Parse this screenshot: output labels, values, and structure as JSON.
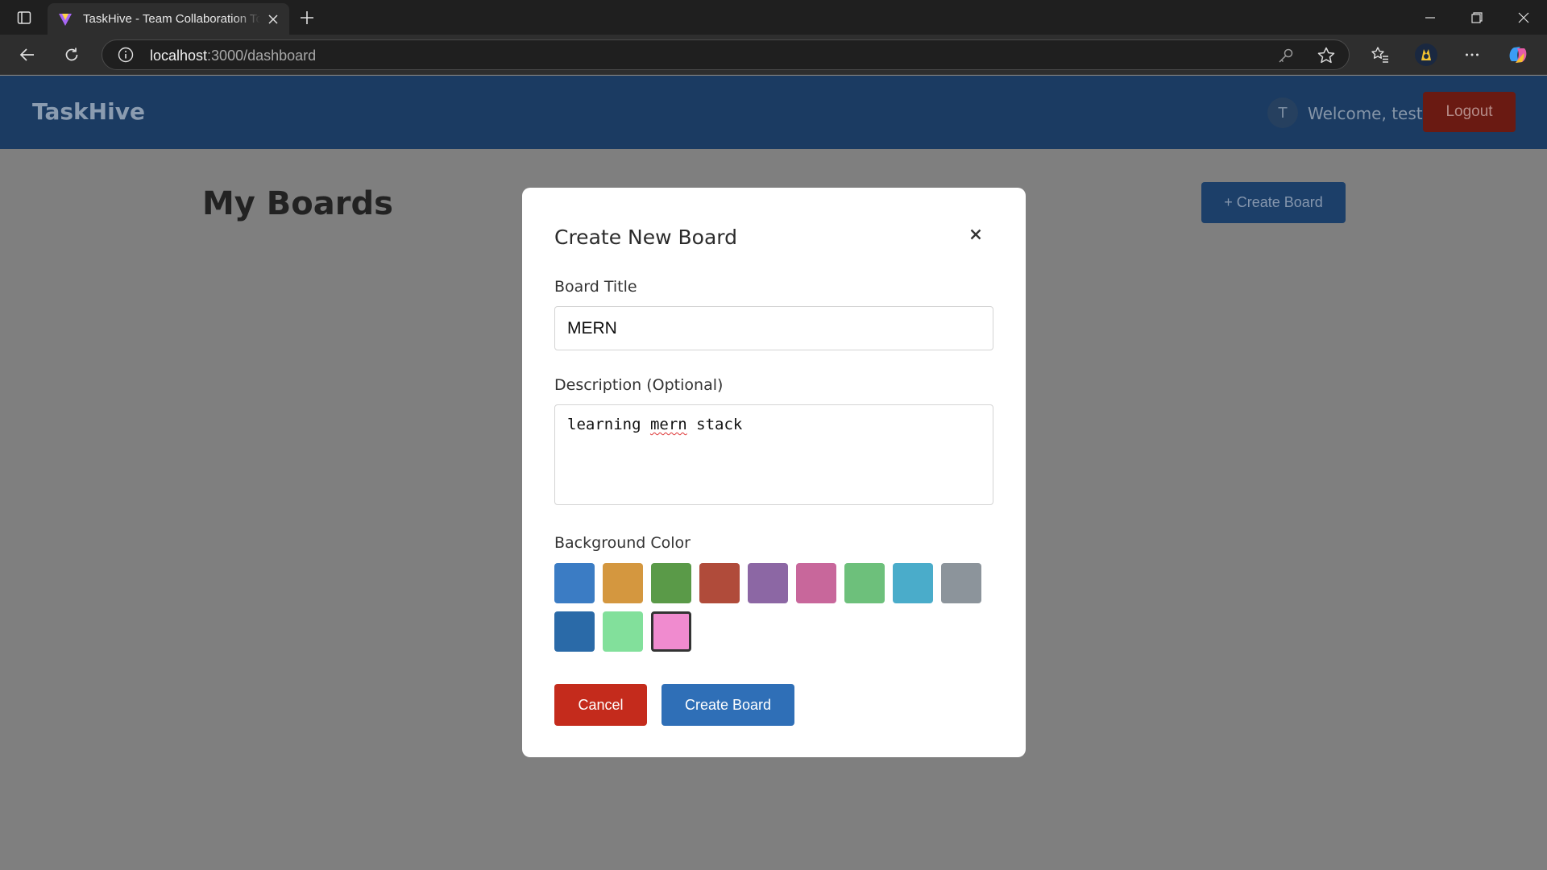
{
  "browser": {
    "tab_title": "TaskHive - Team Collaboration Tool",
    "url_host": "localhost",
    "url_path": ":3000/dashboard",
    "icons": [
      "tab-actions-icon",
      "favicon-icon",
      "tab-close-icon",
      "new-tab-icon",
      "minimize-icon",
      "restore-icon",
      "window-close-icon",
      "back-icon",
      "reload-icon",
      "site-info-icon",
      "password-key-icon",
      "favorite-star-icon",
      "favorites-icon",
      "profile-icon",
      "more-icon",
      "copilot-icon"
    ]
  },
  "header": {
    "logo": "TaskHive",
    "avatar_initial": "T",
    "welcome": "Welcome, test",
    "logout_label": "Logout"
  },
  "main": {
    "title": "My Boards",
    "create_button": "+ Create Board"
  },
  "modal": {
    "title": "Create New Board",
    "close_symbol": "×",
    "title_label": "Board Title",
    "title_value": "MERN",
    "description_label": "Description (Optional)",
    "description_value": "learning mern stack",
    "color_label": "Background Color",
    "colors": [
      "#3b7cc4",
      "#d4973f",
      "#5a9a48",
      "#b04b3a",
      "#8c67a4",
      "#c8679b",
      "#6dc07b",
      "#4aacca",
      "#8c949b",
      "#2a6aa8",
      "#82e09b",
      "#f08bcf"
    ],
    "selected_color": "#f08bcf",
    "cancel_label": "Cancel",
    "submit_label": "Create Board"
  },
  "colors": {
    "app_header": "#1b3b62",
    "overlay": "#7f7f7f",
    "cancel": "#c42b1c",
    "primary": "#2f6fb7"
  }
}
